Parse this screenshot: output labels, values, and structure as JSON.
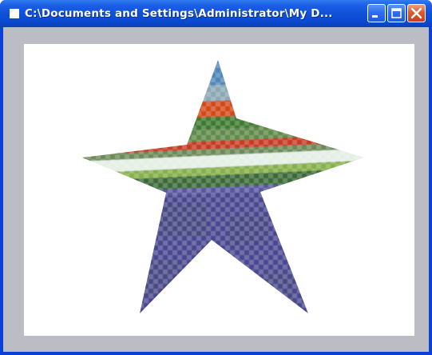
{
  "window": {
    "title": "C:\\Documents and Settings\\Administrator\\My D..."
  },
  "icons": {
    "app": "document-icon",
    "minimize": "minimize-icon",
    "maximize": "maximize-icon",
    "close": "close-icon"
  },
  "colors": {
    "titlebar": "#0b4ad0",
    "frame": "#bcbcc4",
    "canvas": "#ffffff",
    "star_indigo": "#4a4690",
    "close_button": "#e0582e"
  }
}
